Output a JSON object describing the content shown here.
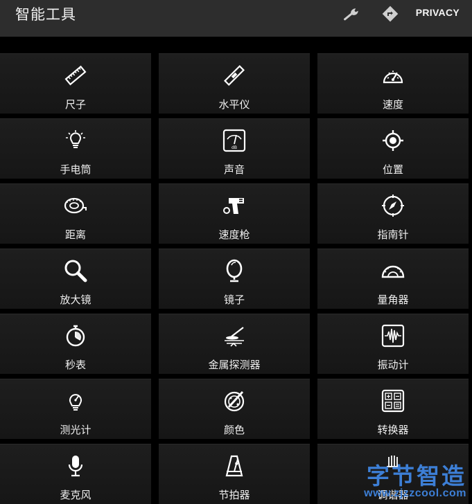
{
  "header": {
    "title": "智能工具",
    "privacy_label": "PRIVACY",
    "icons": [
      "wrench-icon",
      "directions-icon"
    ]
  },
  "tools": [
    {
      "label": "尺子",
      "icon": "ruler-icon"
    },
    {
      "label": "水平仪",
      "icon": "level-icon"
    },
    {
      "label": "速度",
      "icon": "speedometer-icon"
    },
    {
      "label": "手电筒",
      "icon": "bulb-icon"
    },
    {
      "label": "声音",
      "icon": "sound-meter-icon"
    },
    {
      "label": "位置",
      "icon": "location-target-icon"
    },
    {
      "label": "距离",
      "icon": "tape-measure-icon"
    },
    {
      "label": "速度枪",
      "icon": "speed-gun-icon"
    },
    {
      "label": "指南针",
      "icon": "compass-icon"
    },
    {
      "label": "放大镜",
      "icon": "magnifier-icon"
    },
    {
      "label": "镜子",
      "icon": "mirror-icon"
    },
    {
      "label": "量角器",
      "icon": "protractor-icon"
    },
    {
      "label": "秒表",
      "icon": "stopwatch-icon"
    },
    {
      "label": "金属探测器",
      "icon": "metal-detector-icon"
    },
    {
      "label": "振动计",
      "icon": "vibrometer-icon"
    },
    {
      "label": "测光计",
      "icon": "light-meter-icon"
    },
    {
      "label": "颜色",
      "icon": "color-icon"
    },
    {
      "label": "转换器",
      "icon": "converter-icon"
    },
    {
      "label": "麦克风",
      "icon": "microphone-icon"
    },
    {
      "label": "节拍器",
      "icon": "metronome-icon"
    },
    {
      "label": "调谐器",
      "icon": "tuner-icon"
    }
  ],
  "watermark": {
    "line1": "字节智造",
    "line2": "www.zjzzcool.com"
  }
}
